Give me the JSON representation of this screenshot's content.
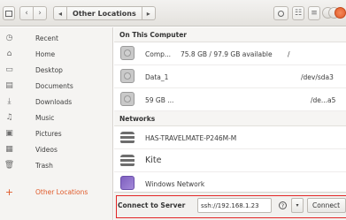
{
  "header": {
    "path_current": "Other Locations",
    "icons": [
      "sidebar-toggle-icon",
      "back-icon",
      "forward-icon",
      "path-left-icon",
      "path-right-icon",
      "search-icon",
      "list-view-icon",
      "menu-icon"
    ]
  },
  "sidebar": {
    "items": [
      {
        "label": "Recent",
        "icon": "clock-icon"
      },
      {
        "label": "Home",
        "icon": "home-icon"
      },
      {
        "label": "Desktop",
        "icon": "desktop-icon"
      },
      {
        "label": "Documents",
        "icon": "documents-icon"
      },
      {
        "label": "Downloads",
        "icon": "downloads-icon"
      },
      {
        "label": "Music",
        "icon": "music-icon"
      },
      {
        "label": "Pictures",
        "icon": "pictures-icon"
      },
      {
        "label": "Videos",
        "icon": "videos-icon"
      },
      {
        "label": "Trash",
        "icon": "trash-icon"
      },
      {
        "label": "Other Locations",
        "icon": "plus-icon",
        "active": true
      }
    ]
  },
  "main": {
    "on_this_computer": "On This Computer",
    "drives": [
      {
        "name": "Comp...",
        "capacity": "75.8 GB / 97.9 GB available",
        "mount": "/"
      },
      {
        "name": "Data_1",
        "capacity": "",
        "mount": "/dev/sda3"
      },
      {
        "name": "59 GB ...",
        "capacity": "",
        "mount": "/de...a5"
      }
    ],
    "networks_heading": "Networks",
    "networks": [
      {
        "name": "HAS-TRAVELMATE-P246M-M",
        "icon": "computer-icon"
      },
      {
        "name": "Kite",
        "icon": "computer-icon"
      },
      {
        "name": "Windows Network",
        "icon": "windows-network-icon"
      }
    ]
  },
  "connect": {
    "label": "Connect to Server",
    "server_value": "ssh://192.168.1.23",
    "help_glyph": "?",
    "dropdown_glyph": "▾",
    "button_label": "Connect"
  },
  "colors": {
    "accent": "#e05a2a",
    "highlight_outline": "#e32626"
  }
}
